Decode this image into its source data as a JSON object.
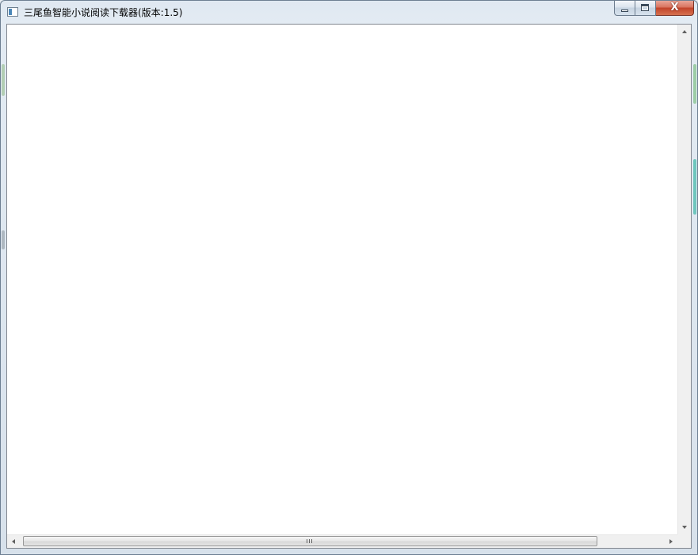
{
  "window": {
    "title": "三尾鱼智能小说阅读下载器(版本:1.5)",
    "icon": "app-window-icon"
  },
  "caption_buttons": {
    "minimize": "minimize-icon",
    "maximize": "maximize-icon",
    "close": "close-icon",
    "close_glyph": "X"
  },
  "content": {
    "text": ""
  },
  "scrollbars": {
    "vertical": {
      "up_icon": "arrow-up-icon",
      "down_icon": "arrow-down-icon"
    },
    "horizontal": {
      "left_icon": "arrow-left-icon",
      "right_icon": "arrow-right-icon",
      "thumb_fraction": 0.88
    }
  },
  "colors": {
    "frame": "#dfe8f1",
    "close_button": "#c2432a",
    "client_background": "#ffffff"
  }
}
